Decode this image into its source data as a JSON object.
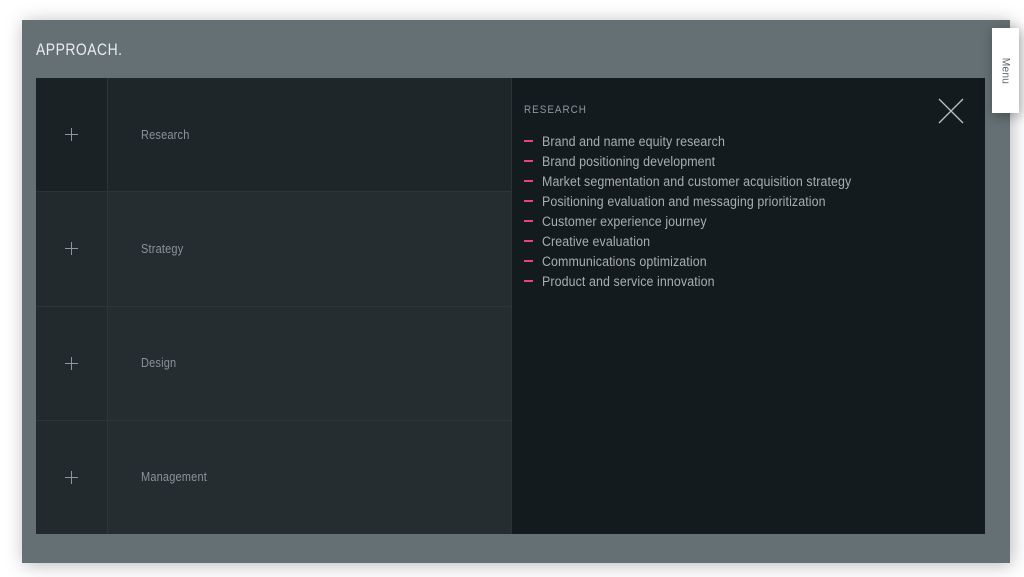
{
  "page": {
    "title": "APPROACH.",
    "background_color": "#ffffff",
    "stage_color": "#647074"
  },
  "accordion": {
    "expand_icon": "plus-icon",
    "rows": [
      {
        "label": "Research",
        "active": true,
        "expand_icon": "plus-icon"
      },
      {
        "label": "Strategy",
        "active": false,
        "expand_icon": "plus-icon"
      },
      {
        "label": "Design",
        "active": false,
        "expand_icon": "plus-icon"
      },
      {
        "label": "Management",
        "active": false,
        "expand_icon": "plus-icon"
      }
    ]
  },
  "detail": {
    "title": "RESEARCH",
    "close_icon": "close-icon",
    "bullet_color": "#e8447a",
    "text_color": "#a7aeb2",
    "background_color": "#141b1f",
    "items": [
      "Brand and name equity research",
      "Brand positioning development",
      "Market segmentation and customer acquisition strategy",
      "Positioning evaluation and messaging prioritization",
      "Customer experience journey",
      "Creative evaluation",
      "Communications optimization",
      "Product and service innovation"
    ]
  },
  "menu_tab": {
    "label": "Menu"
  }
}
